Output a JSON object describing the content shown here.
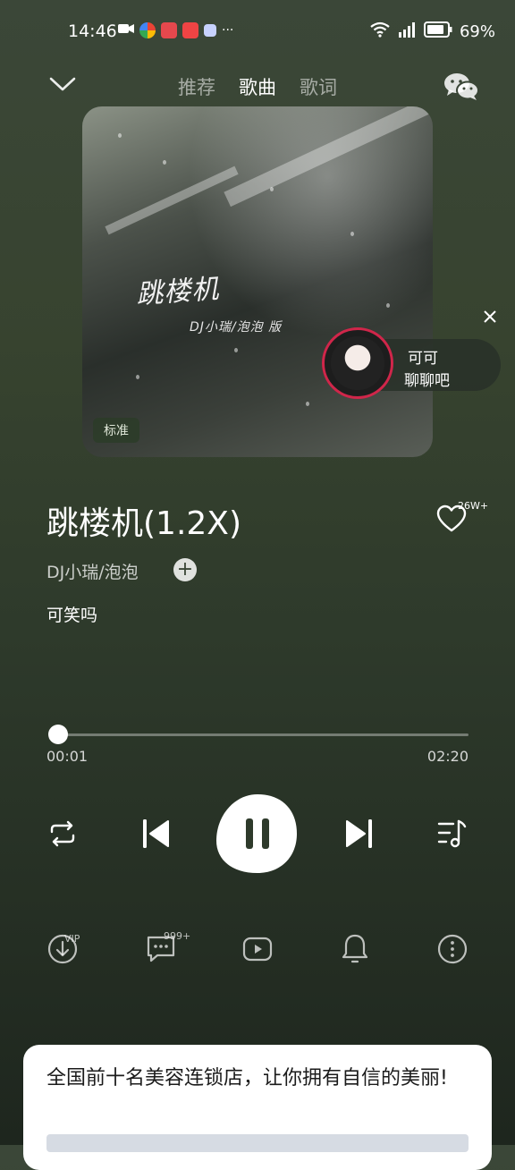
{
  "status_bar": {
    "time": "14:46",
    "battery": "69%",
    "more": "···"
  },
  "nav": {
    "tabs": [
      {
        "label": "推荐",
        "active": false
      },
      {
        "label": "歌曲",
        "active": true
      },
      {
        "label": "歌词",
        "active": false
      }
    ],
    "back_icon": "chevron-down-icon",
    "share_icon": "wechat-icon"
  },
  "album": {
    "cover_title": "跳楼机",
    "cover_subtitle": "DJ小瑞/泡泡 版",
    "quality": "标准"
  },
  "live": {
    "name": "可可",
    "subtitle": "聊聊吧"
  },
  "song": {
    "title": "跳楼机(1.2X)",
    "artist": "DJ小瑞/泡泡",
    "lyric": "可笑吗",
    "like_count": "26W+"
  },
  "progress": {
    "current": "00:01",
    "total": "02:20",
    "fraction": 0.007
  },
  "controls": {
    "repeat": "repeat-icon",
    "prev": "previous-icon",
    "play": "pause-icon",
    "next": "next-icon",
    "playlist": "playlist-icon"
  },
  "secondary": {
    "download_badge": "VIP",
    "comment_badge": "999+"
  },
  "ad": {
    "text": "全国前十名美容连锁店，让你拥有自信的美丽!"
  },
  "colors": {
    "live_ring": "#d0264a",
    "background": "#37432f"
  }
}
